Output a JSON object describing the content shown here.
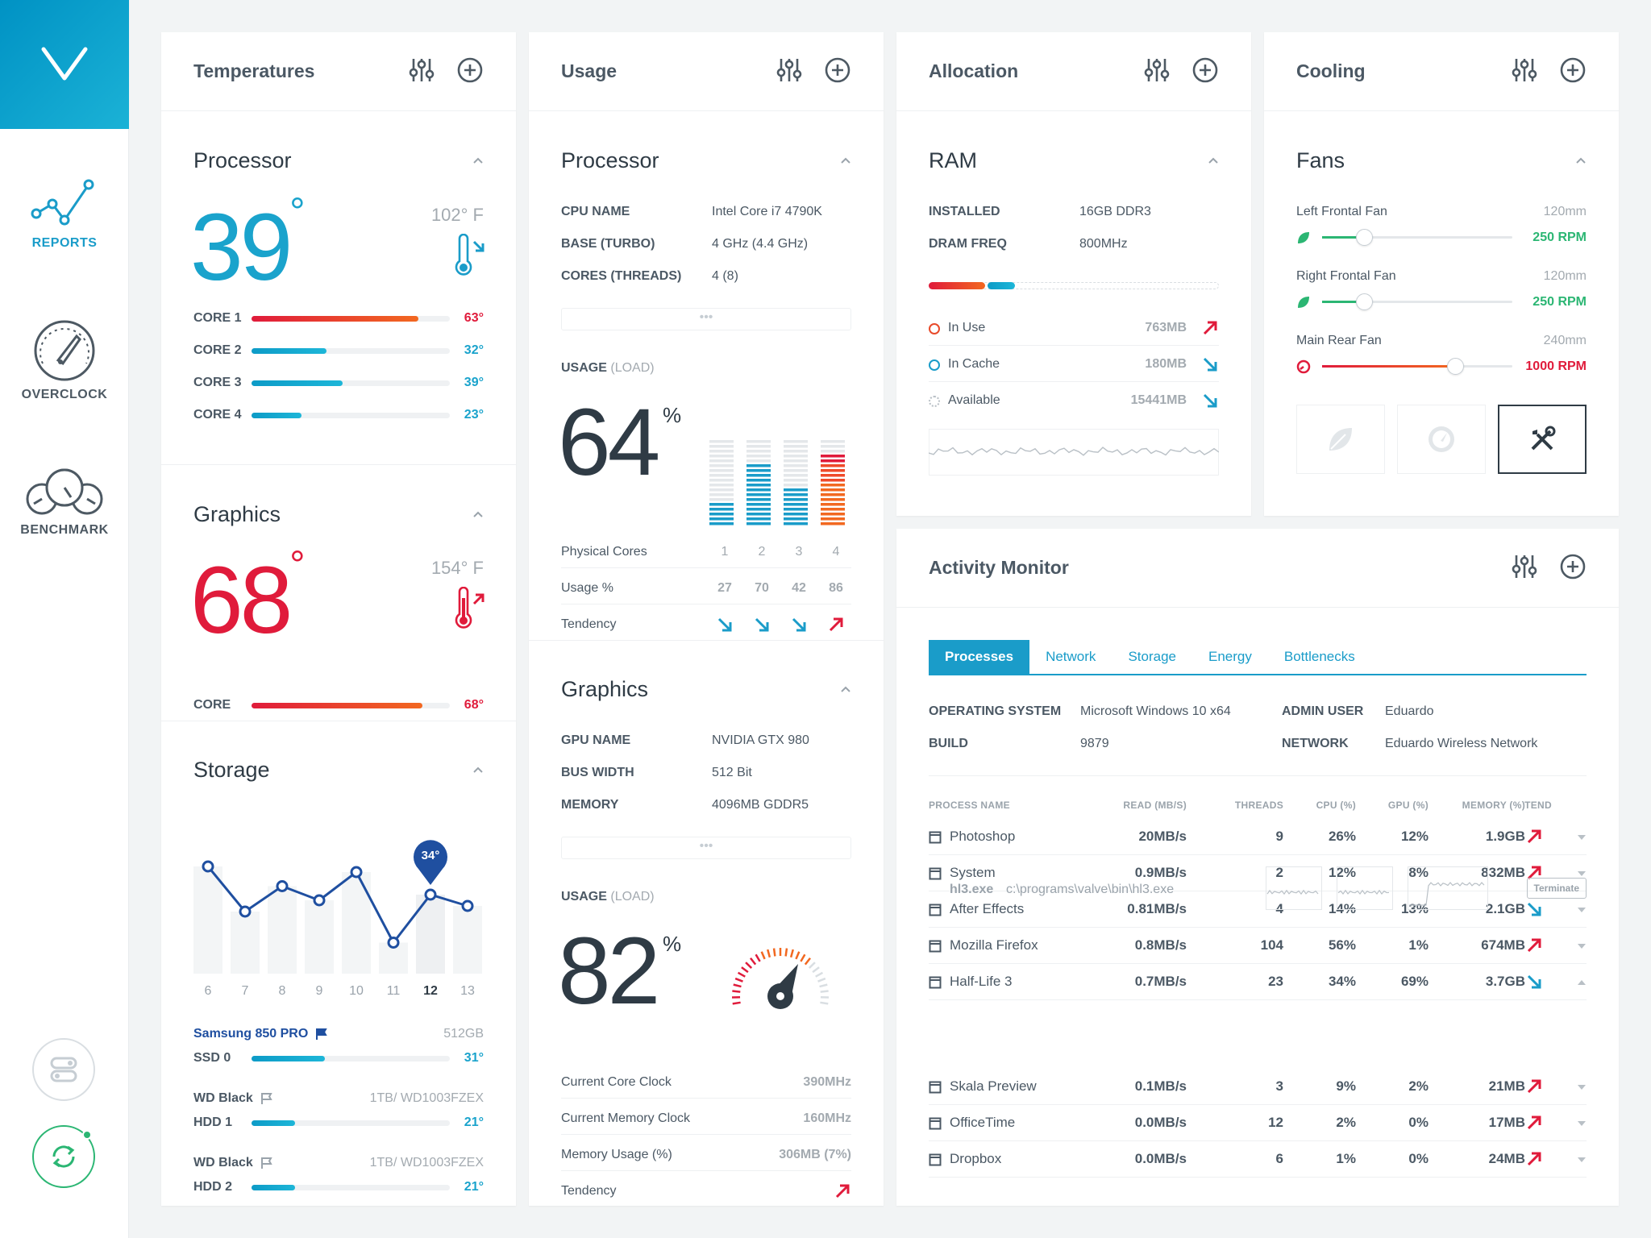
{
  "nav": {
    "reports": "REPORTS",
    "overclock": "OVERCLOCK",
    "benchmark": "BENCHMARK"
  },
  "temps": {
    "title": "Temperatures",
    "processor": {
      "title": "Processor",
      "value": "39",
      "f": "102° F",
      "cores": [
        {
          "label": "CORE 1",
          "pct": 0.84,
          "value": "63°",
          "hot": true
        },
        {
          "label": "CORE 2",
          "pct": 0.38,
          "value": "32°",
          "hot": false
        },
        {
          "label": "CORE 3",
          "pct": 0.46,
          "value": "39°",
          "hot": false
        },
        {
          "label": "CORE 4",
          "pct": 0.25,
          "value": "23°",
          "hot": false
        }
      ]
    },
    "graphics": {
      "title": "Graphics",
      "value": "68",
      "f": "154° F",
      "core_label": "CORE",
      "core_value": "68°",
      "core_pct": 0.86
    },
    "storage": {
      "title": "Storage",
      "pin": "34°",
      "drives": [
        {
          "name": "Samsung 850 PRO",
          "info": "512GB",
          "info2": "",
          "type": "SSD 0",
          "temp": "31°",
          "pct": 0.37,
          "primary": true
        },
        {
          "name": "WD Black",
          "info": "1TB",
          "info2": " / WD1003FZEX",
          "type": "HDD 1",
          "temp": "21°",
          "pct": 0.22,
          "primary": false
        },
        {
          "name": "WD Black",
          "info": "1TB",
          "info2": " / WD1003FZEX",
          "type": "HDD 2",
          "temp": "21°",
          "pct": 0.22,
          "primary": false
        }
      ]
    }
  },
  "chart_data": {
    "type": "line",
    "x": [
      "6",
      "7",
      "8",
      "9",
      "10",
      "11",
      "12",
      "13"
    ],
    "values": [
      38,
      22,
      31,
      26,
      36,
      11,
      28,
      24
    ],
    "highlight_index": 6,
    "highlight_label": "34°",
    "ylim": [
      0,
      48
    ]
  },
  "usage": {
    "title": "Usage",
    "processor": {
      "title": "Processor",
      "specs": [
        {
          "k": "CPU NAME",
          "v": "Intel Core i7 4790K"
        },
        {
          "k": "BASE (TURBO)",
          "v": "4 GHz (4.4 GHz)"
        },
        {
          "k": "CORES (THREADS)",
          "v": "4 (8)"
        }
      ],
      "usage_label": "USAGE",
      "load_label": "(LOAD)",
      "value": "64",
      "pct": "%",
      "cores_label": "Physical Cores",
      "cores": [
        "1",
        "2",
        "3",
        "4"
      ],
      "usage_pct_label": "Usage %",
      "usage_vals": [
        27,
        70,
        42,
        86
      ],
      "tendency_label": "Tendency",
      "tend": [
        "down",
        "down",
        "down",
        "up"
      ]
    },
    "graphics": {
      "title": "Graphics",
      "specs": [
        {
          "k": "GPU NAME",
          "v": "NVIDIA GTX 980"
        },
        {
          "k": "BUS WIDTH",
          "v": "512 Bit"
        },
        {
          "k": "MEMORY",
          "v": "4096MB GDDR5"
        }
      ],
      "usage_label": "USAGE",
      "load_label": "(LOAD)",
      "value": "82",
      "pct": "%",
      "stats": [
        {
          "k": "Current Core Clock",
          "v": "390MHz"
        },
        {
          "k": "Current Memory Clock",
          "v": "160MHz"
        },
        {
          "k": "Memory Usage (%)",
          "v": "306MB (7%)"
        },
        {
          "k": "Tendency",
          "v": ""
        }
      ]
    }
  },
  "alloc": {
    "title": "Allocation",
    "ram": {
      "title": "RAM",
      "specs": [
        {
          "k": "INSTALLED",
          "v": "16GB DDR3"
        },
        {
          "k": "DRAM FREQ",
          "v": "800MHz"
        }
      ],
      "items": [
        {
          "k": "In Use",
          "v": "763MB",
          "dir": "up"
        },
        {
          "k": "In Cache",
          "v": "180MB",
          "dir": "down"
        },
        {
          "k": "Available",
          "v": "15441MB",
          "dir": "down"
        }
      ]
    }
  },
  "cooling": {
    "title": "Cooling",
    "fans": {
      "title": "Fans",
      "items": [
        {
          "name": "Left Frontal Fan",
          "size": "120mm",
          "rpm": "250 RPM",
          "level": 0.22,
          "mode": "eco"
        },
        {
          "name": "Right Frontal Fan",
          "size": "120mm",
          "rpm": "250 RPM",
          "level": 0.22,
          "mode": "eco"
        },
        {
          "name": "Main Rear Fan",
          "size": "240mm",
          "rpm": "1000 RPM",
          "level": 0.7,
          "mode": "perf"
        }
      ]
    }
  },
  "activity": {
    "title": "Activity Monitor",
    "tabs": [
      "Processes",
      "Network",
      "Storage",
      "Energy",
      "Bottlenecks"
    ],
    "info": [
      {
        "k": "OPERATING SYSTEM",
        "v": "Microsoft Windows 10 x64"
      },
      {
        "k": "ADMIN USER",
        "v": "Eduardo"
      },
      {
        "k": "BUILD",
        "v": "9879"
      },
      {
        "k": "NETWORK",
        "v": "Eduardo Wireless Network"
      }
    ],
    "cols": [
      "PROCESS NAME",
      "READ (MB/S)",
      "THREADS",
      "CPU (%)",
      "GPU (%)",
      "MEMORY (%)",
      "TEND"
    ],
    "rows": [
      {
        "name": "Photoshop",
        "read": "20MB/s",
        "threads": "9",
        "cpu": "26%",
        "gpu": "12%",
        "mem": "1.9GB",
        "dir": "up"
      },
      {
        "name": "System",
        "read": "0.9MB/s",
        "threads": "2",
        "cpu": "12%",
        "gpu": "8%",
        "mem": "832MB",
        "dir": "up"
      },
      {
        "name": "After Effects",
        "read": "0.81MB/s",
        "threads": "4",
        "cpu": "14%",
        "gpu": "13%",
        "mem": "2.1GB",
        "dir": "down"
      },
      {
        "name": "Mozilla Firefox",
        "read": "0.8MB/s",
        "threads": "104",
        "cpu": "56%",
        "gpu": "1%",
        "mem": "674MB",
        "dir": "up"
      },
      {
        "name": "Half-Life 3",
        "read": "0.7MB/s",
        "threads": "23",
        "cpu": "34%",
        "gpu": "69%",
        "mem": "3.7GB",
        "dir": "down"
      },
      {
        "name": "Skala Preview",
        "read": "0.1MB/s",
        "threads": "3",
        "cpu": "9%",
        "gpu": "2%",
        "mem": "21MB",
        "dir": "up"
      },
      {
        "name": "OfficeTime",
        "read": "0.0MB/s",
        "threads": "12",
        "cpu": "2%",
        "gpu": "0%",
        "mem": "17MB",
        "dir": "up"
      },
      {
        "name": "Dropbox",
        "read": "0.0MB/s",
        "threads": "6",
        "cpu": "1%",
        "gpu": "0%",
        "mem": "24MB",
        "dir": "up"
      }
    ],
    "expanded": {
      "exe": "hl3.exe",
      "path": "c:\\programs\\valve\\bin\\hl3.exe",
      "terminate": "Terminate"
    }
  }
}
